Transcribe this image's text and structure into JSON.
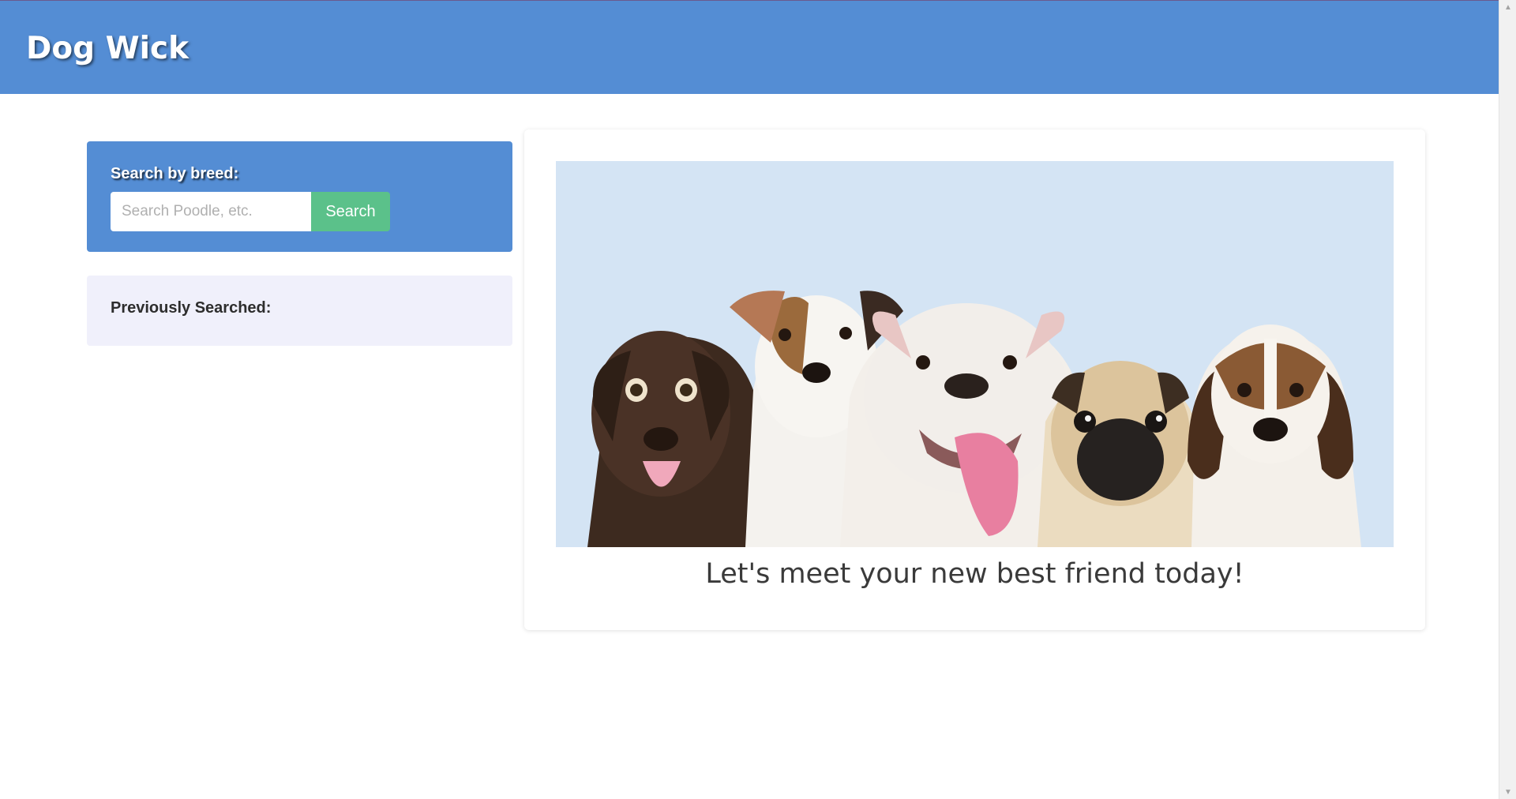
{
  "header": {
    "title": "Dog Wick"
  },
  "search": {
    "label": "Search by breed:",
    "placeholder": "Search Poodle, etc.",
    "button_label": "Search"
  },
  "history": {
    "label": "Previously Searched:"
  },
  "hero": {
    "image": "puppies-group-photo",
    "caption": "Let's meet your new best friend today!"
  },
  "colors": {
    "brand_blue": "#548dd4",
    "search_green": "#5bc18a",
    "history_bg": "#f0f0fb",
    "hero_bg": "#d4e4f4"
  }
}
